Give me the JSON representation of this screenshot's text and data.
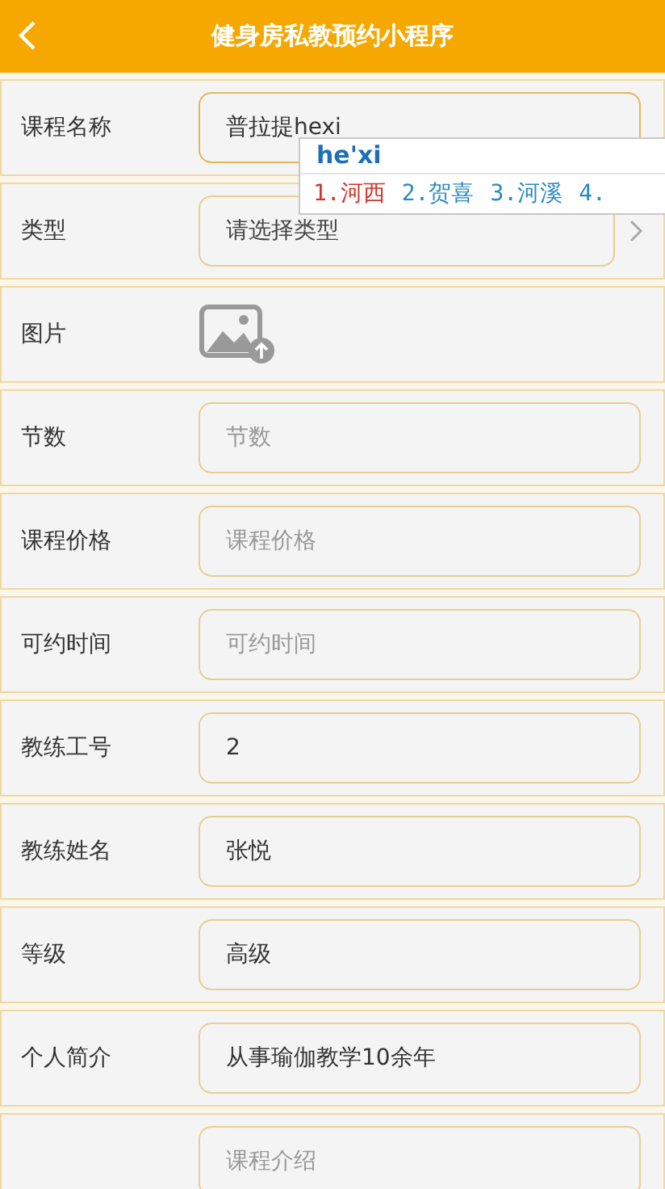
{
  "header": {
    "title": "健身房私教预约小程序"
  },
  "fields": [
    {
      "kind": "text",
      "label": "课程名称",
      "value": "普拉提hexi",
      "focused": true
    },
    {
      "kind": "select",
      "label": "类型",
      "placeholder": "请选择类型"
    },
    {
      "kind": "image",
      "label": "图片"
    },
    {
      "kind": "text",
      "label": "节数",
      "placeholder": "节数"
    },
    {
      "kind": "text",
      "label": "课程价格",
      "placeholder": "课程价格"
    },
    {
      "kind": "text",
      "label": "可约时间",
      "placeholder": "可约时间"
    },
    {
      "kind": "text",
      "label": "教练工号",
      "value": "2"
    },
    {
      "kind": "text",
      "label": "教练姓名",
      "value": "张悦"
    },
    {
      "kind": "text",
      "label": "等级",
      "value": "高级"
    },
    {
      "kind": "text",
      "label": "个人简介",
      "value": "从事瑜伽教学10余年"
    },
    {
      "kind": "text",
      "placeholder": "课程介绍"
    }
  ],
  "ime": {
    "composition": "he'xi",
    "candidates": [
      {
        "text": "1.河西",
        "selected": true
      },
      {
        "text": "2.贺喜",
        "selected": false
      },
      {
        "text": "3.河溪",
        "selected": false
      },
      {
        "text": "4.",
        "selected": false
      }
    ]
  }
}
